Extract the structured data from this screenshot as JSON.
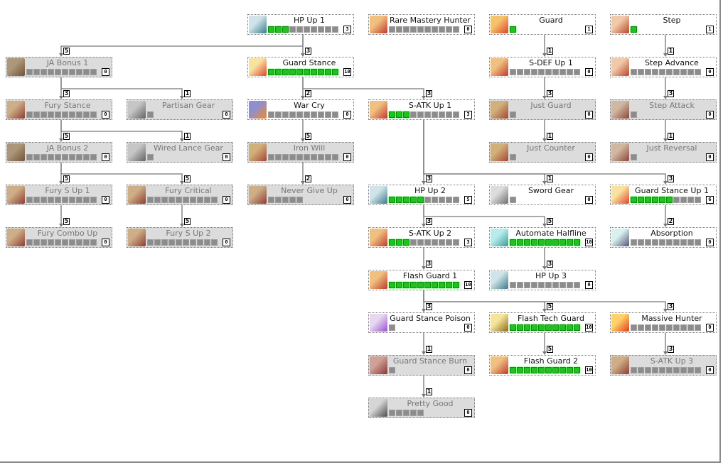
{
  "colors": {
    "unlocked_bg": "#ffffff",
    "locked_bg": "#dcdcdc",
    "pip_on": "#1fc21f",
    "pip_off": "#8c8c8c",
    "wire": "#777777"
  },
  "nodes": [
    {
      "id": "hp1",
      "name": "HP Up 1",
      "level": 3,
      "max": 10,
      "locked": false,
      "icon": "hp-icon"
    },
    {
      "id": "rmh",
      "name": "Rare Mastery Hunter",
      "level": 0,
      "max": 10,
      "locked": false,
      "icon": "sword-icon"
    },
    {
      "id": "guard",
      "name": "Guard",
      "level": 1,
      "max": 1,
      "locked": false,
      "icon": "shield-icon"
    },
    {
      "id": "step",
      "name": "Step",
      "level": 1,
      "max": 1,
      "locked": false,
      "icon": "step-icon"
    },
    {
      "id": "ja1",
      "name": "JA Bonus 1",
      "level": 0,
      "max": 10,
      "locked": true,
      "icon": "ja-icon"
    },
    {
      "id": "gs",
      "name": "Guard Stance",
      "level": 10,
      "max": 10,
      "locked": false,
      "icon": "stance-icon"
    },
    {
      "id": "sdef1",
      "name": "S-DEF Up 1",
      "level": 0,
      "max": 10,
      "locked": false,
      "icon": "sword-icon"
    },
    {
      "id": "stepadv",
      "name": "Step Advance",
      "level": 0,
      "max": 10,
      "locked": false,
      "icon": "step-icon"
    },
    {
      "id": "fury",
      "name": "Fury Stance",
      "level": 0,
      "max": 10,
      "locked": true,
      "icon": "sword-icon"
    },
    {
      "id": "partisan",
      "name": "Partisan Gear",
      "level": 0,
      "max": 1,
      "locked": true,
      "icon": "gear-icon"
    },
    {
      "id": "warcry",
      "name": "War Cry",
      "level": 0,
      "max": 10,
      "locked": false,
      "icon": "warcry-icon"
    },
    {
      "id": "satk1",
      "name": "S-ATK Up 1",
      "level": 3,
      "max": 10,
      "locked": false,
      "icon": "sword-icon"
    },
    {
      "id": "jg",
      "name": "Just Guard",
      "level": 0,
      "max": 1,
      "locked": true,
      "icon": "shield-icon"
    },
    {
      "id": "stepatk",
      "name": "Step Attack",
      "level": 0,
      "max": 1,
      "locked": true,
      "icon": "step-icon"
    },
    {
      "id": "ja2",
      "name": "JA Bonus 2",
      "level": 0,
      "max": 10,
      "locked": true,
      "icon": "ja-icon"
    },
    {
      "id": "wired",
      "name": "Wired Lance Gear",
      "level": 0,
      "max": 1,
      "locked": true,
      "icon": "gear-icon"
    },
    {
      "id": "ironwill",
      "name": "Iron Will",
      "level": 0,
      "max": 10,
      "locked": true,
      "icon": "shield-icon"
    },
    {
      "id": "jc",
      "name": "Just Counter",
      "level": 0,
      "max": 1,
      "locked": true,
      "icon": "shield-icon"
    },
    {
      "id": "jr",
      "name": "Just Reversal",
      "level": 0,
      "max": 1,
      "locked": true,
      "icon": "step-icon"
    },
    {
      "id": "fs1",
      "name": "Fury S Up 1",
      "level": 0,
      "max": 10,
      "locked": true,
      "icon": "sword-icon"
    },
    {
      "id": "fcrit",
      "name": "Fury Critical",
      "level": 0,
      "max": 10,
      "locked": true,
      "icon": "sword-icon"
    },
    {
      "id": "ngu",
      "name": "Never Give Up",
      "level": 0,
      "max": 5,
      "locked": true,
      "icon": "sword-icon"
    },
    {
      "id": "hp2",
      "name": "HP Up 2",
      "level": 5,
      "max": 10,
      "locked": false,
      "icon": "hp-icon"
    },
    {
      "id": "swordgear",
      "name": "Sword Gear",
      "level": 0,
      "max": 1,
      "locked": false,
      "icon": "gear-icon"
    },
    {
      "id": "gsu1",
      "name": "Guard Stance Up 1",
      "level": 6,
      "max": 10,
      "locked": false,
      "icon": "stance-icon"
    },
    {
      "id": "fcombo",
      "name": "Fury Combo Up",
      "level": 0,
      "max": 10,
      "locked": true,
      "icon": "sword-icon"
    },
    {
      "id": "fs2",
      "name": "Fury S Up 2",
      "level": 0,
      "max": 10,
      "locked": true,
      "icon": "sword-icon"
    },
    {
      "id": "satk2",
      "name": "S-ATK Up 2",
      "level": 3,
      "max": 10,
      "locked": false,
      "icon": "sword-icon"
    },
    {
      "id": "auto",
      "name": "Automate Halfline",
      "level": 10,
      "max": 10,
      "locked": false,
      "icon": "automate-icon"
    },
    {
      "id": "absorb",
      "name": "Absorption",
      "level": 0,
      "max": 10,
      "locked": false,
      "icon": "absorb-icon"
    },
    {
      "id": "fg1",
      "name": "Flash Guard 1",
      "level": 10,
      "max": 10,
      "locked": false,
      "icon": "sword-icon"
    },
    {
      "id": "hp3",
      "name": "HP Up 3",
      "level": 0,
      "max": 10,
      "locked": false,
      "icon": "hp-icon"
    },
    {
      "id": "gsp",
      "name": "Guard Stance Poison",
      "level": 0,
      "max": 1,
      "locked": false,
      "icon": "poison-icon"
    },
    {
      "id": "ftg",
      "name": "Flash Tech Guard",
      "level": 10,
      "max": 10,
      "locked": false,
      "icon": "tech-icon"
    },
    {
      "id": "mh",
      "name": "Massive Hunter",
      "level": 0,
      "max": 10,
      "locked": false,
      "icon": "massive-icon"
    },
    {
      "id": "gsb",
      "name": "Guard Stance Burn",
      "level": 0,
      "max": 1,
      "locked": true,
      "icon": "burn-icon"
    },
    {
      "id": "fg2",
      "name": "Flash Guard 2",
      "level": 10,
      "max": 10,
      "locked": false,
      "icon": "sword-icon"
    },
    {
      "id": "satk3",
      "name": "S-ATK Up 3",
      "level": 0,
      "max": 10,
      "locked": true,
      "icon": "sword-icon"
    },
    {
      "id": "pg",
      "name": "Pretty Good",
      "level": 0,
      "max": 5,
      "locked": true,
      "icon": "pretty-good-icon"
    }
  ],
  "edges": [
    {
      "from": "hp1",
      "to": "ja1",
      "req": "5"
    },
    {
      "from": "hp1",
      "to": "gs",
      "req": "3"
    },
    {
      "from": "ja1",
      "to": "fury",
      "req": "3"
    },
    {
      "from": "ja1",
      "to": "partisan",
      "req": "1"
    },
    {
      "from": "fury",
      "to": "ja2",
      "req": "5"
    },
    {
      "from": "fury",
      "to": "wired",
      "req": "1"
    },
    {
      "from": "ja2",
      "to": "fs1",
      "req": "5"
    },
    {
      "from": "ja2",
      "to": "fcrit",
      "req": "5"
    },
    {
      "from": "fs1",
      "to": "fcombo",
      "req": "5"
    },
    {
      "from": "fcrit",
      "to": "fs2",
      "req": "5"
    },
    {
      "from": "gs",
      "to": "warcry",
      "req": "2"
    },
    {
      "from": "gs",
      "to": "satk1",
      "req": "3"
    },
    {
      "from": "warcry",
      "to": "ironwill",
      "req": "5"
    },
    {
      "from": "ironwill",
      "to": "ngu",
      "req": "2"
    },
    {
      "from": "guard",
      "to": "sdef1",
      "req": "1"
    },
    {
      "from": "sdef1",
      "to": "jg",
      "req": "3"
    },
    {
      "from": "jg",
      "to": "jc",
      "req": "1"
    },
    {
      "from": "step",
      "to": "stepadv",
      "req": "1"
    },
    {
      "from": "stepadv",
      "to": "stepatk",
      "req": "3"
    },
    {
      "from": "stepatk",
      "to": "jr",
      "req": "1"
    },
    {
      "from": "satk1",
      "to": "hp2",
      "req": "3"
    },
    {
      "from": "satk1",
      "to": "swordgear",
      "req": "1"
    },
    {
      "from": "satk1",
      "to": "gsu1",
      "req": "3"
    },
    {
      "from": "gsu1",
      "to": "absorb",
      "req": "2"
    },
    {
      "from": "hp2",
      "to": "satk2",
      "req": "3"
    },
    {
      "from": "hp2",
      "to": "auto",
      "req": "5"
    },
    {
      "from": "satk2",
      "to": "fg1",
      "req": "3"
    },
    {
      "from": "auto",
      "to": "hp3",
      "req": "3"
    },
    {
      "from": "fg1",
      "to": "gsp",
      "req": "3"
    },
    {
      "from": "fg1",
      "to": "ftg",
      "req": "5"
    },
    {
      "from": "fg1",
      "to": "mh",
      "req": "3"
    },
    {
      "from": "gsp",
      "to": "gsb",
      "req": "1"
    },
    {
      "from": "gsb",
      "to": "pg",
      "req": "1"
    },
    {
      "from": "ftg",
      "to": "fg2",
      "req": "5"
    },
    {
      "from": "mh",
      "to": "satk3",
      "req": "3"
    }
  ]
}
